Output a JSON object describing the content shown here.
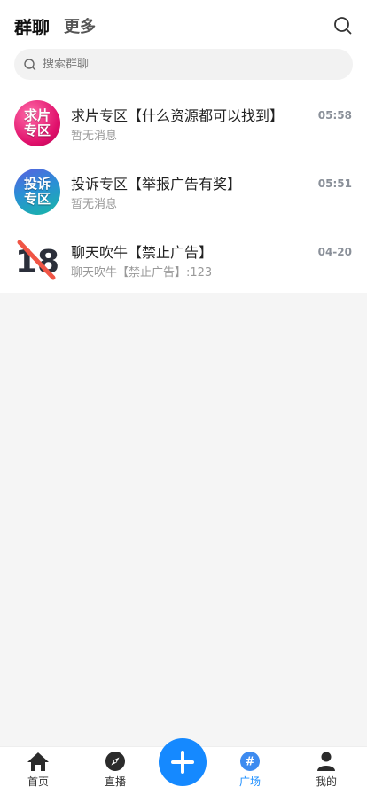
{
  "header": {
    "tab_active": "群聊",
    "tab_more": "更多"
  },
  "search": {
    "placeholder": "搜索群聊"
  },
  "groups": [
    {
      "avatar_line1": "求片",
      "avatar_line2": "专区",
      "title": "求片专区【什么资源都可以找到】",
      "last_message": "暂无消息",
      "time": "05:58"
    },
    {
      "avatar_line1": "投诉",
      "avatar_line2": "专区",
      "title": "投诉专区【举报广告有奖】",
      "last_message": "暂无消息",
      "time": "05:51"
    },
    {
      "avatar_text": "18",
      "title": "聊天吹牛【禁止广告】",
      "last_message": "聊天吹牛【禁止广告】:123",
      "time": "04-20"
    }
  ],
  "bottom_nav": [
    {
      "label": "首页",
      "icon": "home-icon"
    },
    {
      "label": "直播",
      "icon": "compass-icon"
    },
    {
      "label": "",
      "icon": "plus-icon"
    },
    {
      "label": "广场",
      "icon": "hashtag-icon",
      "active": true
    },
    {
      "label": "我的",
      "icon": "user-icon"
    }
  ],
  "colors": {
    "accent": "#1589ff",
    "active_label": "#1e8fff"
  }
}
